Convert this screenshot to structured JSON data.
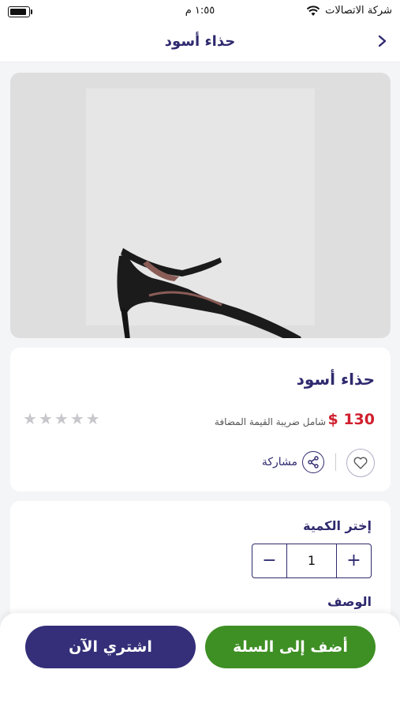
{
  "status_bar": {
    "carrier": "شركة الاتصالات",
    "time": "١:٥٥ م"
  },
  "header": {
    "title": "حذاء أسود",
    "back_icon": "chevron-right-icon"
  },
  "product": {
    "name": "حذاء أسود",
    "price": "$ 130",
    "vat_note": "شامل ضريبة القيمة المضافة",
    "rating": 0,
    "rating_max": 5,
    "share_label": "مشاركة",
    "price_color": "#d01f2e"
  },
  "quantity": {
    "title": "إختر الكمية",
    "value": "1",
    "minus_icon": "minus-icon",
    "plus_icon": "plus-icon"
  },
  "description": {
    "title": "الوصف"
  },
  "actions": {
    "add_to_cart": "أضف إلى السلة",
    "buy_now": "اشتري الآن",
    "add_to_cart_color": "#3e8f24",
    "buy_now_color": "#342f78"
  }
}
